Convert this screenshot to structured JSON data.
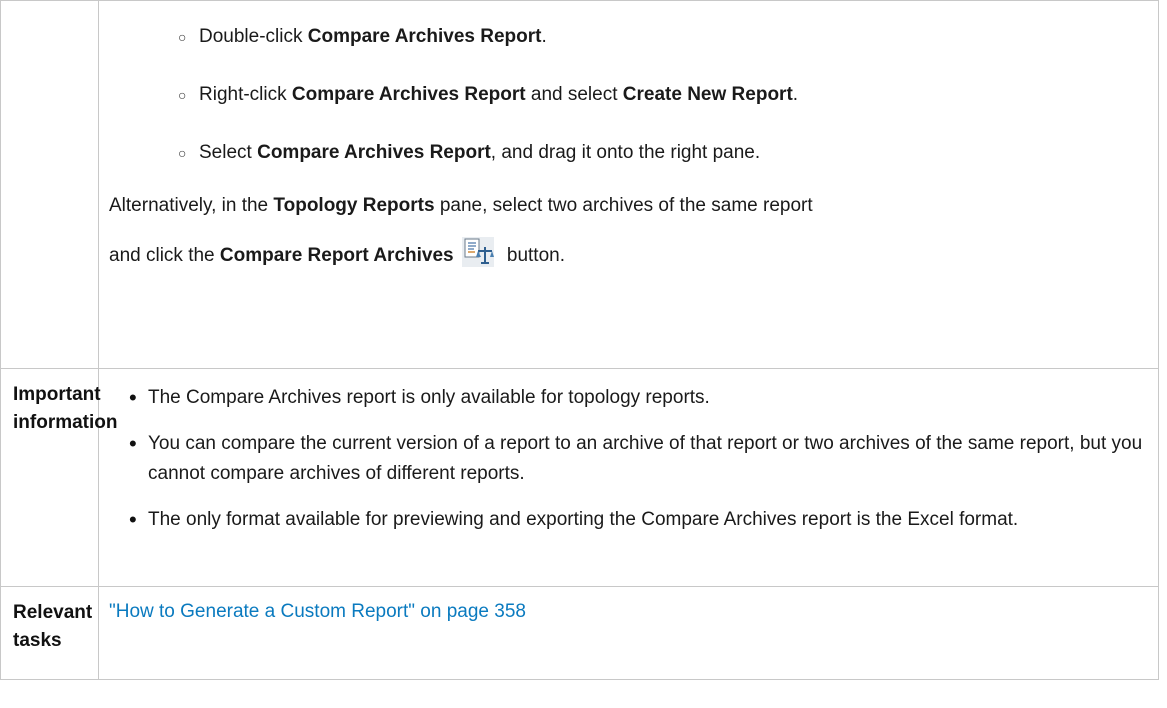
{
  "steps": [
    {
      "pre": "Double-click ",
      "b1": "Compare Archives Report",
      "mid": ".",
      "b2": "",
      "post": ""
    },
    {
      "pre": "Right-click ",
      "b1": "Compare Archives Report",
      "mid": " and select ",
      "b2": "Create New Report",
      "post": "."
    },
    {
      "pre": "Select ",
      "b1": "Compare Archives Report",
      "mid": ", and drag it onto the right pane.",
      "b2": "",
      "post": ""
    }
  ],
  "alternative": {
    "pre": "Alternatively, in the ",
    "b1": "Topology Reports",
    "mid": " pane, select two archives of the same report",
    "line2_pre": "and click the ",
    "b2": "Compare Report Archives",
    "post": " button.",
    "icon": "compare-report-archives-icon"
  },
  "important": {
    "label": "Important information",
    "items": [
      "The Compare Archives report is only available for topology reports.",
      "You can compare the current version of a report to an archive of that report or two archives of the same report, but you cannot compare archives of different reports.",
      "The only format available for previewing and exporting the Compare Archives report is the Excel format."
    ]
  },
  "relevant": {
    "label": "Relevant tasks",
    "link_text": "\"How to Generate a Custom Report\" on page 358"
  },
  "colors": {
    "link": "#0a7abf",
    "border": "#c8c8c8"
  }
}
